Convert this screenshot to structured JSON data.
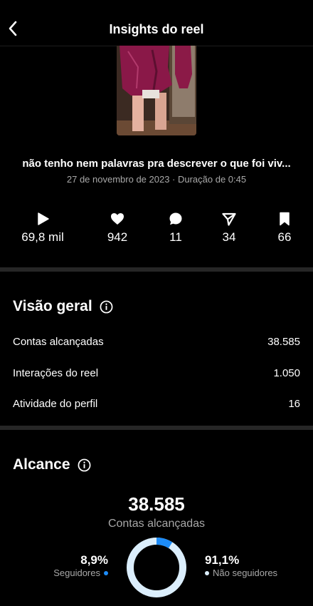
{
  "header": {
    "title": "Insights do reel"
  },
  "reel": {
    "caption": "não tenho nem palavras pra descrever o que foi viv...",
    "meta": "27 de novembro de 2023 · Duração de 0:45"
  },
  "stats": {
    "plays": "69,8 mil",
    "likes": "942",
    "comments": "11",
    "shares": "34",
    "saves": "66"
  },
  "overview": {
    "title": "Visão geral",
    "rows": [
      {
        "label": "Contas alcançadas",
        "value": "38.585"
      },
      {
        "label": "Interações do reel",
        "value": "1.050"
      },
      {
        "label": "Atividade do perfil",
        "value": "16"
      }
    ]
  },
  "reach": {
    "title": "Alcance",
    "total": "38.585",
    "total_label": "Contas alcançadas",
    "followers_pct": "8,9%",
    "followers_label": "Seguidores",
    "non_followers_pct": "91,1%",
    "non_followers_label": "Não seguidores",
    "followers_fraction": 0.089,
    "followers_color": "#1d8cf8",
    "non_followers_color": "#dbeefc"
  },
  "icons": {
    "back": "chevron-left-icon",
    "plays": "play-icon",
    "likes": "heart-icon",
    "comments": "comment-icon",
    "shares": "send-icon",
    "saves": "bookmark-icon",
    "info": "info-icon"
  }
}
